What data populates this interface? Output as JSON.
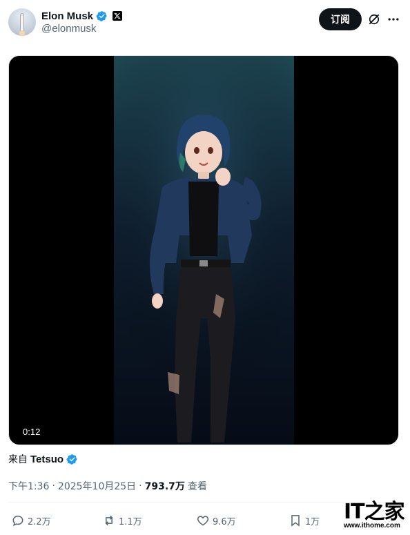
{
  "author": {
    "display_name": "Elon Musk",
    "handle": "@elonmusk",
    "verified_icon": "verified-badge-icon",
    "affiliate_icon": "x-logo-icon"
  },
  "header_actions": {
    "subscribe_label": "订阅",
    "grok_icon": "grok-icon",
    "more_icon": "more-options-icon"
  },
  "media": {
    "duration": "0:12"
  },
  "source": {
    "prefix": "来自",
    "name": "Tetsuo"
  },
  "meta": {
    "time": "下午1:36",
    "separator": "·",
    "date": "2025年10月25日",
    "views": "793.7万",
    "views_label": "查看"
  },
  "actions": {
    "replies": "2.2万",
    "reposts": "1.1万",
    "likes": "9.6万",
    "bookmarks": "1万"
  },
  "watermark": {
    "logo_text": "IT之家",
    "url": "www.ithome.com"
  },
  "colors": {
    "accent_verified": "#1d9bf0",
    "text_primary": "#0f1419",
    "text_secondary": "#536471"
  }
}
